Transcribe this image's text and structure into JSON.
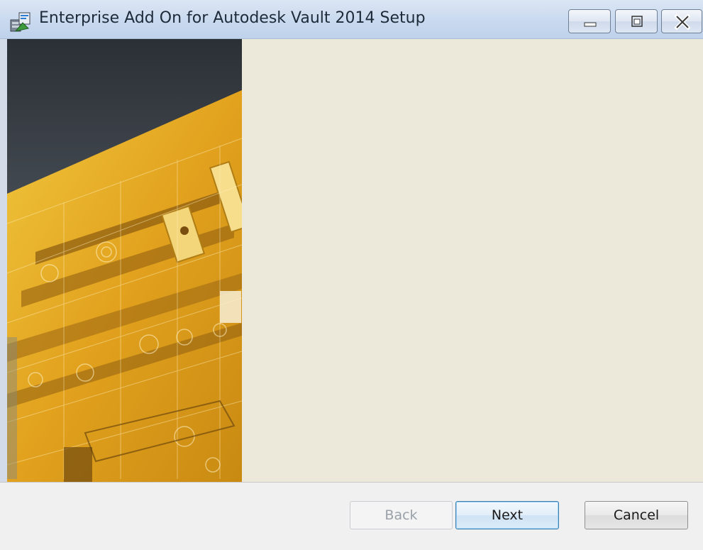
{
  "window": {
    "title": "Enterprise Add On for Autodesk Vault 2014 Setup",
    "app_icon": "installer-package-icon",
    "controls": {
      "minimize": "minimize-icon",
      "maximize": "maximize-icon",
      "close": "close-icon"
    }
  },
  "banner": {
    "image": "autodesk-yellow-cad-banner"
  },
  "footer": {
    "back_label": "Back",
    "next_label": "Next",
    "cancel_label": "Cancel",
    "back_enabled": false
  },
  "colors": {
    "titlebar": "#c9d9ee",
    "content": "#ece9da",
    "footer": "#f0f0f0",
    "banner_yellow": "#e8b128",
    "banner_sky": "#3a3f45"
  }
}
